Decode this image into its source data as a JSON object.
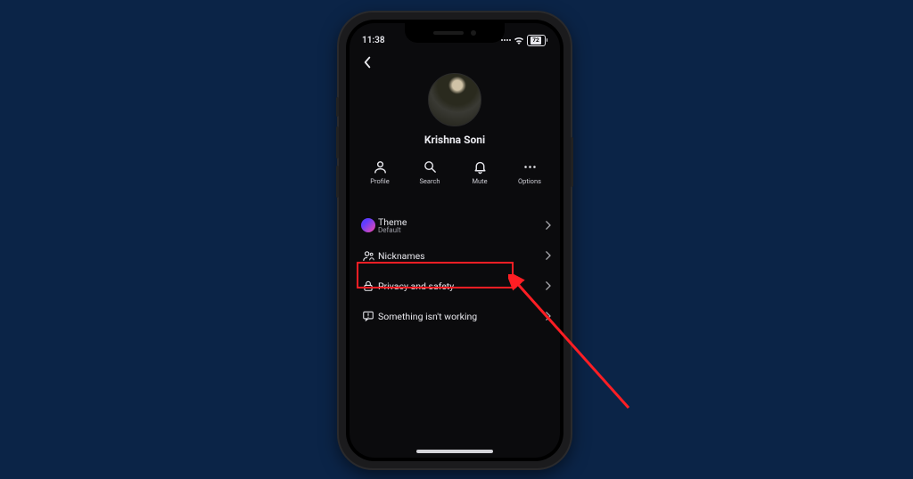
{
  "status": {
    "time": "11:38",
    "battery_pct": "72"
  },
  "profile": {
    "name": "Krishna Soni"
  },
  "actions": {
    "profile": "Profile",
    "search": "Search",
    "mute": "Mute",
    "options": "Options"
  },
  "rows": {
    "theme": {
      "label": "Theme",
      "sub": "Default"
    },
    "nicknames": {
      "label": "Nicknames"
    },
    "privacy": {
      "label": "Privacy and safety"
    },
    "bug": {
      "label": "Something isn't working"
    }
  },
  "annotation": {
    "highlight": "privacy"
  }
}
